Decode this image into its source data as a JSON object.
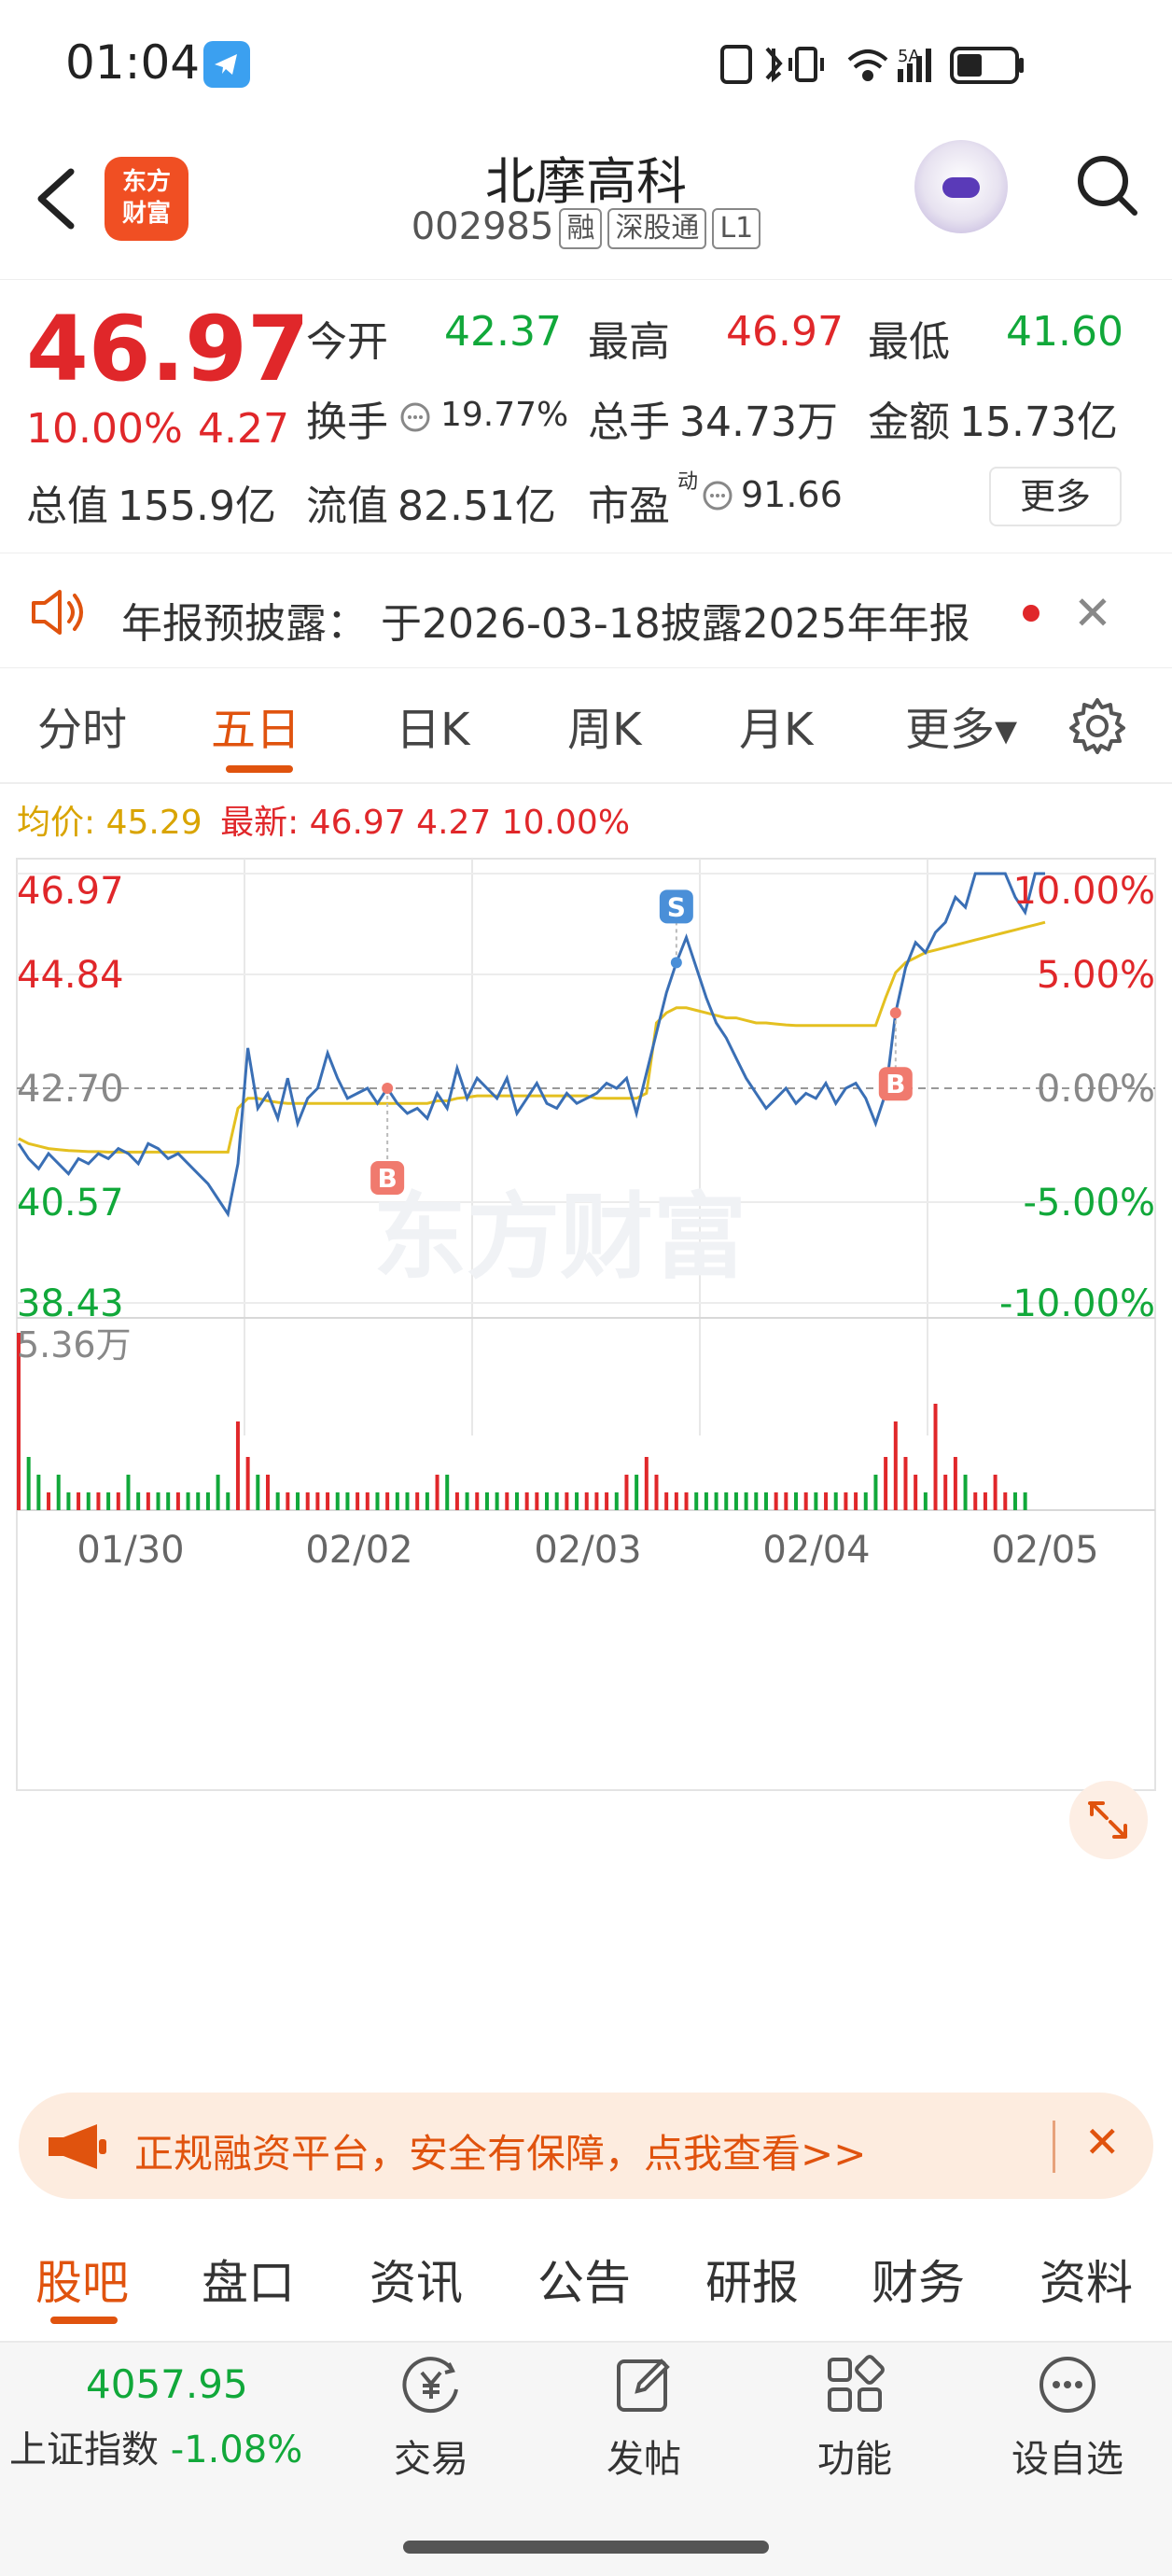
{
  "status_bar": {
    "time": "01:04"
  },
  "header": {
    "logo_line1": "东方",
    "logo_line2": "财富",
    "stock_name": "北摩高科",
    "stock_code": "002985",
    "tags": [
      "融",
      "深股通",
      "L1"
    ]
  },
  "quote": {
    "price": "46.97",
    "change_pct": "10.00%",
    "change_abs": "4.27",
    "open_label": "今开",
    "open": "42.37",
    "high_label": "最高",
    "high": "46.97",
    "low_label": "最低",
    "low": "41.60",
    "turnover_label": "换手",
    "turnover": "19.77%",
    "volume_label": "总手",
    "volume": "34.73万",
    "amount_label": "金额",
    "amount": "15.73亿",
    "mktcap_label": "总值",
    "mktcap": "155.9亿",
    "float_label": "流值",
    "float_cap": "82.51亿",
    "pe_label": "市盈",
    "pe_sup": "动",
    "pe": "91.66",
    "more_label": "更多"
  },
  "notice": {
    "text": "年报预披露：  于2026-03-18披露2025年年报"
  },
  "chart_tabs": [
    {
      "label": "分时",
      "active": false
    },
    {
      "label": "五日",
      "active": true
    },
    {
      "label": "日K",
      "active": false
    },
    {
      "label": "周K",
      "active": false
    },
    {
      "label": "月K",
      "active": false
    },
    {
      "label": "更多▾",
      "active": false
    }
  ],
  "chart_info": {
    "avg_label": "均价: 45.29",
    "latest_label": "最新: 46.97  4.27  10.00%"
  },
  "chart_data": {
    "type": "line",
    "title": "",
    "x_labels": [
      "01/30",
      "02/02",
      "02/03",
      "02/04",
      "02/05"
    ],
    "y_price_ticks": [
      "46.97",
      "44.84",
      "42.70",
      "40.57",
      "38.43"
    ],
    "y_pct_ticks": [
      "10.00%",
      "5.00%",
      "0.00%",
      "-5.00%",
      "-10.00%"
    ],
    "ylim": [
      38.43,
      46.97
    ],
    "prev_close": 42.7,
    "volume_max_label": "5.36万",
    "watermark": "东方财富",
    "series": [
      {
        "name": "price",
        "color": "#3a6fb5",
        "values": [
          41.6,
          41.3,
          41.1,
          41.4,
          41.2,
          41.0,
          41.3,
          41.2,
          41.4,
          41.3,
          41.5,
          41.4,
          41.2,
          41.6,
          41.5,
          41.3,
          41.4,
          41.2,
          41.0,
          40.8,
          40.5,
          40.2,
          41.2,
          43.5,
          42.3,
          42.6,
          42.1,
          42.9,
          42.0,
          42.5,
          42.7,
          43.4,
          42.9,
          42.5,
          42.6,
          42.7,
          42.4,
          42.7,
          42.4,
          42.2,
          42.3,
          42.1,
          42.6,
          42.3,
          43.1,
          42.5,
          42.9,
          42.7,
          42.5,
          42.9,
          42.2,
          42.5,
          42.8,
          42.4,
          42.3,
          42.6,
          42.4,
          42.5,
          42.6,
          42.8,
          42.7,
          42.9,
          42.2,
          43.0,
          43.8,
          44.6,
          45.2,
          45.7,
          45.1,
          44.5,
          44.0,
          43.7,
          43.3,
          42.9,
          42.6,
          42.3,
          42.5,
          42.7,
          42.4,
          42.6,
          42.5,
          42.8,
          42.4,
          42.7,
          42.8,
          42.5,
          42.0,
          42.6,
          44.2,
          45.1,
          45.6,
          45.4,
          45.8,
          46.0,
          46.5,
          46.3,
          46.97,
          46.97,
          46.97,
          46.97,
          46.5,
          46.2,
          46.97,
          46.97
        ]
      },
      {
        "name": "avg",
        "color": "#e4c020",
        "values": [
          41.7,
          41.6,
          41.55,
          41.5,
          41.48,
          41.46,
          41.45,
          41.44,
          41.44,
          41.43,
          41.43,
          41.43,
          41.43,
          41.43,
          41.43,
          41.43,
          41.43,
          41.43,
          41.43,
          41.43,
          41.43,
          41.43,
          42.3,
          42.5,
          42.5,
          42.45,
          42.42,
          42.4,
          42.4,
          42.4,
          42.4,
          42.4,
          42.4,
          42.4,
          42.4,
          42.4,
          42.4,
          42.4,
          42.4,
          42.4,
          42.4,
          42.4,
          42.45,
          42.45,
          42.5,
          42.52,
          42.55,
          42.55,
          42.55,
          42.55,
          42.55,
          42.55,
          42.55,
          42.55,
          42.55,
          42.55,
          42.55,
          42.55,
          42.5,
          42.5,
          42.5,
          42.5,
          42.5,
          42.6,
          44.0,
          44.2,
          44.3,
          44.3,
          44.25,
          44.2,
          44.15,
          44.1,
          44.1,
          44.05,
          44.0,
          44.0,
          43.98,
          43.96,
          43.95,
          43.95,
          43.95,
          43.95,
          43.95,
          43.95,
          43.95,
          43.95,
          43.95,
          44.5,
          45.0,
          45.2,
          45.3,
          45.4,
          45.45,
          45.5,
          45.55,
          45.6,
          45.65,
          45.7,
          45.75,
          45.8,
          45.85,
          45.9,
          45.95,
          46.0
        ]
      }
    ],
    "trade_markers": [
      "B",
      "S",
      "B"
    ],
    "volume": [
      10,
      3,
      2,
      1,
      2,
      1,
      1,
      1,
      1,
      1,
      1,
      2,
      1,
      1,
      1,
      1,
      1,
      1,
      1,
      1,
      2,
      1,
      5,
      3,
      2,
      2,
      1,
      1,
      1,
      1,
      1,
      1,
      1,
      1,
      1,
      1,
      1,
      1,
      1,
      1,
      1,
      1,
      2,
      2,
      1,
      1,
      1,
      1,
      1,
      1,
      1,
      1,
      1,
      1,
      1,
      1,
      1,
      1,
      1,
      1,
      1,
      2,
      2,
      3,
      2,
      1,
      1,
      1,
      1,
      1,
      1,
      1,
      1,
      1,
      1,
      1,
      1,
      1,
      1,
      1,
      1,
      1,
      1,
      1,
      1,
      1,
      2,
      3,
      5,
      3,
      2,
      1,
      6,
      2,
      3,
      2,
      1,
      1,
      2,
      1,
      1,
      1
    ]
  },
  "promo": {
    "text": "正规融资平台，安全有保障，点我查看>>"
  },
  "bottom_tabs": [
    {
      "label": "股吧",
      "active": true
    },
    {
      "label": "盘口",
      "active": false
    },
    {
      "label": "资讯",
      "active": false
    },
    {
      "label": "公告",
      "active": false
    },
    {
      "label": "研报",
      "active": false
    },
    {
      "label": "财务",
      "active": false
    },
    {
      "label": "资料",
      "active": false
    }
  ],
  "bottom_nav": {
    "index_value": "4057.95",
    "index_name": "上证指数",
    "index_change": "-1.08%",
    "items": [
      "交易",
      "发帖",
      "功能",
      "设自选"
    ]
  },
  "colors": {
    "up": "#e0272a",
    "down": "#11a83a",
    "accent": "#e0530e"
  }
}
